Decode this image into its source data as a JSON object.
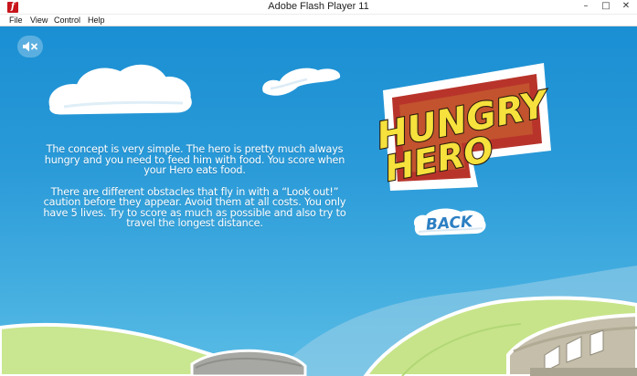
{
  "window": {
    "title": "Adobe Flash Player 11",
    "minimize_glyph": "–",
    "maximize_glyph": "□",
    "close_glyph": "✕"
  },
  "app_icon": "flash-icon",
  "menu": {
    "items": [
      "File",
      "View",
      "Control",
      "Help"
    ]
  },
  "game": {
    "sound_icon": "speaker-muted-icon",
    "logo": {
      "line1": "HUNGRY",
      "line2": "HERO"
    },
    "instructions": [
      "The concept is very simple. The hero is pretty much always hungry and you need to feed him with food. You score when your Hero eats food.",
      "There are different obstacles that fly in with a “Look out!” caution before they appear. Avoid them at all costs. You only have 5 lives. Try to score as much as possible and also try to travel the longest distance."
    ],
    "back_label": "BACK"
  },
  "colors": {
    "sky_top": "#1a8fd3",
    "sky_bottom": "#5bbde6",
    "logo_yellow": "#f6e13d",
    "logo_red": "#b8342b",
    "hill_green": "#c6e487",
    "back_text": "#2d7fc3"
  }
}
